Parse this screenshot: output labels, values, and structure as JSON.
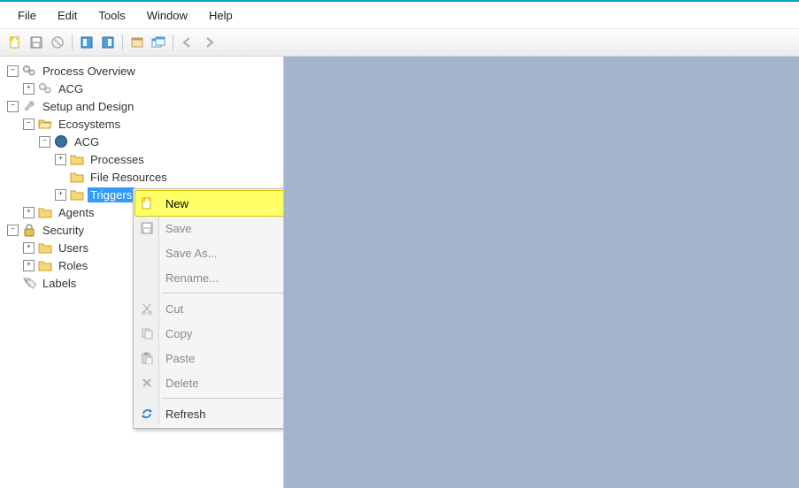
{
  "menubar": {
    "file": "File",
    "edit": "Edit",
    "tools": "Tools",
    "window": "Window",
    "help": "Help"
  },
  "tree": {
    "process_overview": "Process Overview",
    "acg_overview": "ACG",
    "setup_design": "Setup and Design",
    "ecosystems": "Ecosystems",
    "acg_eco": "ACG",
    "processes": "Processes",
    "file_resources": "File Resources",
    "triggers": "Triggers",
    "agents": "Agents",
    "security": "Security",
    "users": "Users",
    "roles": "Roles",
    "labels": "Labels"
  },
  "ctx": {
    "new": "New",
    "save": "Save",
    "save_as": "Save As...",
    "rename": "Rename...",
    "cut": "Cut",
    "copy": "Copy",
    "paste": "Paste",
    "delete": "Delete",
    "refresh": "Refresh"
  }
}
